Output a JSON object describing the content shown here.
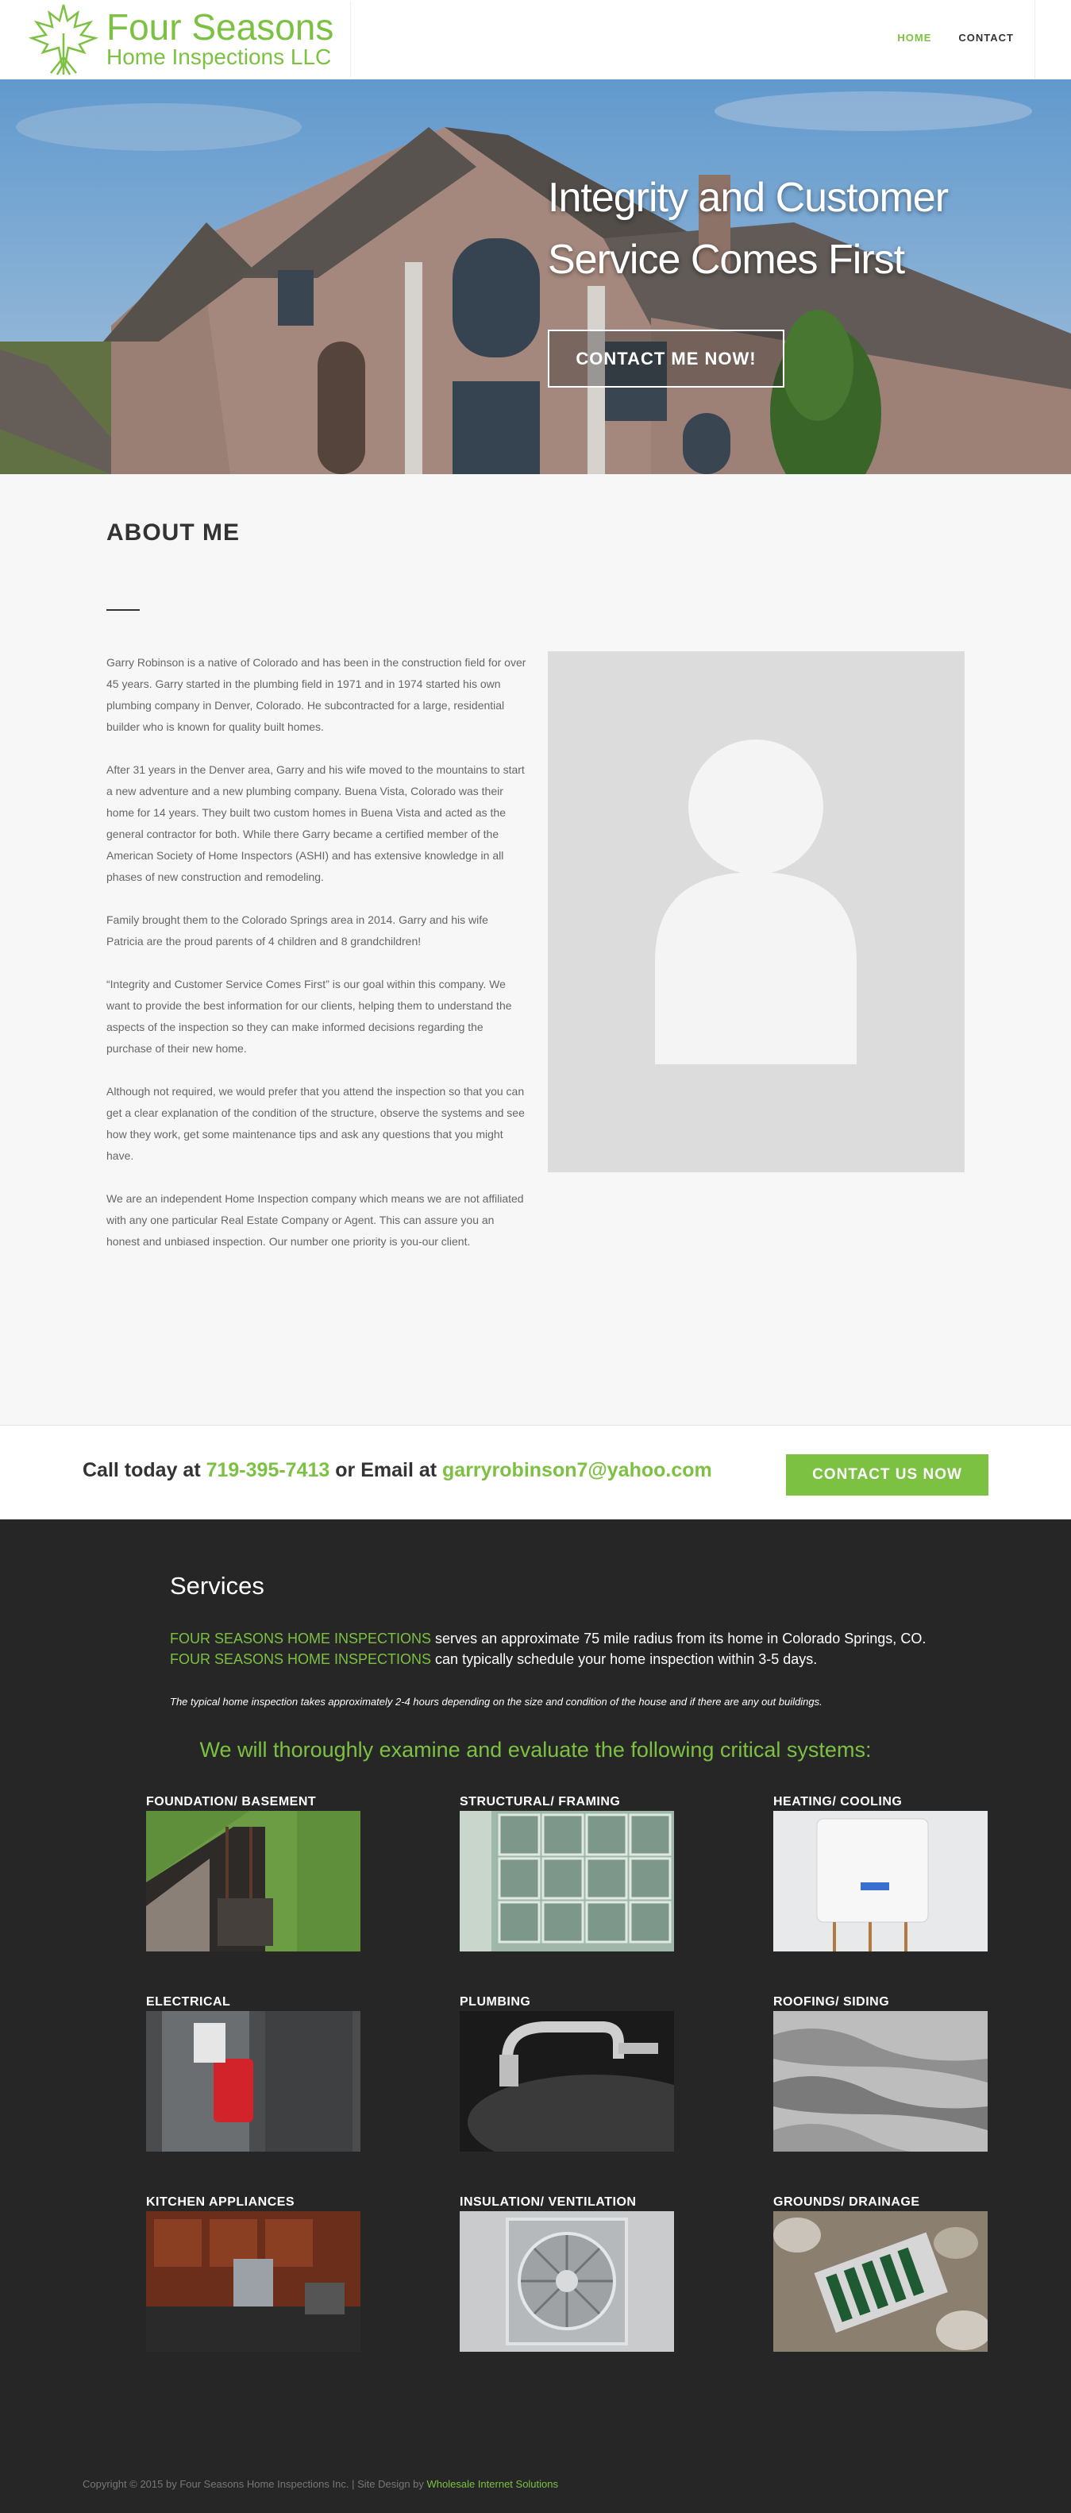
{
  "header": {
    "logo_line1": "Four Seasons",
    "logo_line2": "Home Inspections LLC",
    "nav": [
      {
        "label": "HOME"
      },
      {
        "label": "CONTACT"
      }
    ]
  },
  "hero": {
    "title": "Integrity and Customer Service Comes First",
    "button_label": "CONTACT ME NOW!"
  },
  "about": {
    "heading": "ABOUT ME",
    "paragraphs": [
      "Garry Robinson is a native of Colorado and has been in the construction field for over 45 years. Garry started in the plumbing field in 1971 and in 1974 started his own plumbing company in Denver, Colorado. He subcontracted for a large, residential builder who is known for quality built homes.",
      "After 31 years in the Denver area, Garry and his wife moved to the mountains to start a new adventure and a new plumbing company. Buena Vista, Colorado was their home for 14 years. They built two custom homes in Buena Vista and acted as the general contractor for both. While there Garry became a certified member of the American Society of Home Inspectors (ASHI) and has extensive knowledge in all phases of new construction and remodeling.",
      "Family brought them to the Colorado Springs area in 2014. Garry and his wife Patricia are the proud parents of 4 children and 8 grandchildren!",
      "“Integrity and Customer Service Comes First” is our goal within this company. We want to provide the best information for our clients, helping them to understand the aspects of the inspection so they can make informed decisions regarding the purchase of their new home.",
      "Although not required, we would prefer that you attend the inspection so that you can get a clear explanation of the condition of the structure, observe the systems and see how they work, get some maintenance tips and ask any questions that you might have.",
      "We are an independent Home Inspection company which means we are not affiliated with any one particular Real Estate Company or Agent. This can assure you an honest and unbiased inspection. Our number one priority is you-our client."
    ]
  },
  "cta": {
    "prefix": "Call today at ",
    "phone": "719-395-7413",
    "middle": " or Email at ",
    "email": "garryrobinson7@yahoo.com",
    "button_label": "CONTACT US NOW"
  },
  "services": {
    "heading": "Services",
    "brand": "FOUR SEASONS HOME INSPECTIONS",
    "line1_rest": " serves an approximate 75 mile radius from its home in Colorado Springs, CO.",
    "line2_rest": " can typically schedule your home inspection within 3-5 days.",
    "note": "The typical home inspection takes approximately 2-4 hours depending on the size and condition of the house and if there are any out buildings.",
    "subheading": "We will thoroughly examine and evaluate the following critical systems:",
    "items": [
      {
        "label": "FOUNDATION/ BASEMENT"
      },
      {
        "label": "STRUCTURAL/ FRAMING"
      },
      {
        "label": "HEATING/ COOLING"
      },
      {
        "label": "ELECTRICAL"
      },
      {
        "label": "PLUMBING"
      },
      {
        "label": "ROOFING/ SIDING"
      },
      {
        "label": "KITCHEN APPLIANCES"
      },
      {
        "label": "INSULATION/ VENTILATION"
      },
      {
        "label": "GROUNDS/ DRAINAGE"
      }
    ]
  },
  "footer": {
    "copyright": "Copyright © 2015 by Four Seasons Home Inspections Inc. | Site Design by ",
    "link": "Wholesale Internet Solutions"
  },
  "colors": {
    "accent": "#7cc142",
    "dark_bg": "#262626",
    "light_bg": "#f7f7f7"
  }
}
